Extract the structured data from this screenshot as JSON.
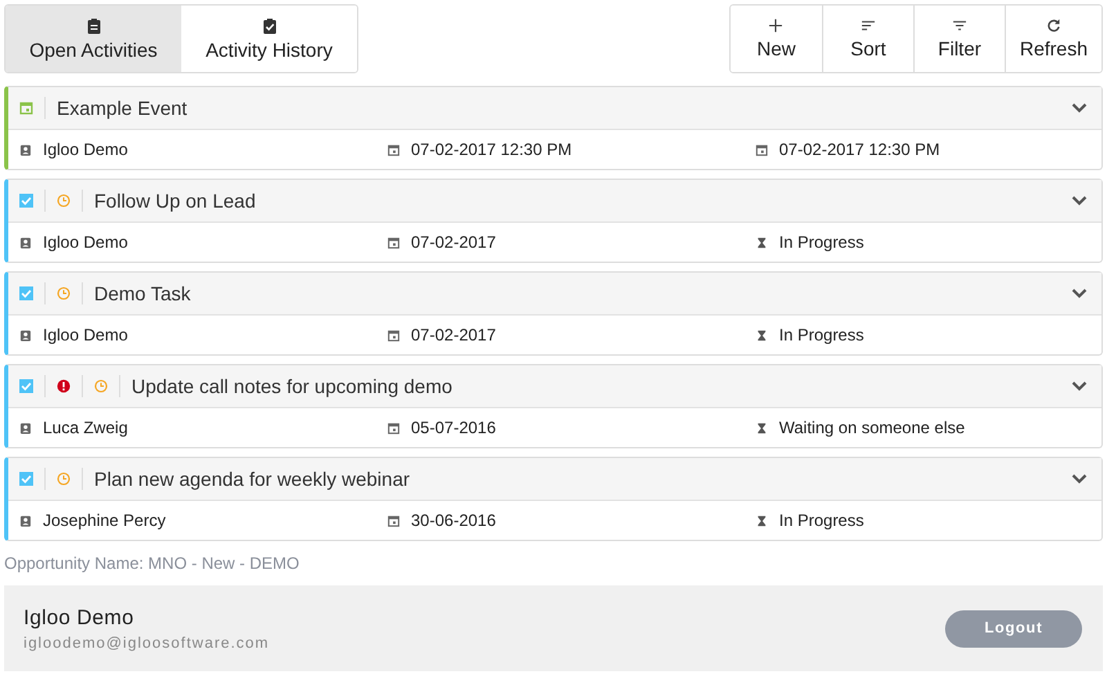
{
  "tabs": [
    {
      "label": "Open Activities",
      "kind": "open",
      "selected": true
    },
    {
      "label": "Activity History",
      "kind": "history",
      "selected": false
    }
  ],
  "actions": [
    {
      "label": "New",
      "kind": "new"
    },
    {
      "label": "Sort",
      "kind": "sort"
    },
    {
      "label": "Filter",
      "kind": "filter"
    },
    {
      "label": "Refresh",
      "kind": "refresh"
    }
  ],
  "activities": [
    {
      "kind": "event",
      "title": "Example Event",
      "high_priority": false,
      "owner": "Igloo Demo",
      "date": "07-02-2017 12:30 PM",
      "column_3": "07-02-2017 12:30 PM"
    },
    {
      "kind": "task",
      "title": "Follow Up on Lead",
      "checked": true,
      "high_priority": false,
      "owner": "Igloo Demo",
      "date": "07-02-2017",
      "column_3": "In Progress"
    },
    {
      "kind": "task",
      "title": "Demo Task",
      "checked": true,
      "high_priority": false,
      "owner": "Igloo Demo",
      "date": "07-02-2017",
      "column_3": "In Progress"
    },
    {
      "kind": "task",
      "title": "Update call notes for upcoming demo",
      "checked": true,
      "high_priority": true,
      "owner": "Luca Zweig",
      "date": "05-07-2016",
      "column_3": "Waiting on someone else"
    },
    {
      "kind": "task",
      "title": "Plan new agenda for weekly webinar",
      "checked": true,
      "high_priority": false,
      "owner": "Josephine Percy",
      "date": "30-06-2016",
      "column_3": "In Progress"
    }
  ],
  "context": "Opportunity Name: MNO - New - DEMO",
  "footer": {
    "name": "Igloo Demo",
    "email": "igloodemo@igloosoftware.com",
    "logout": "Logout"
  }
}
